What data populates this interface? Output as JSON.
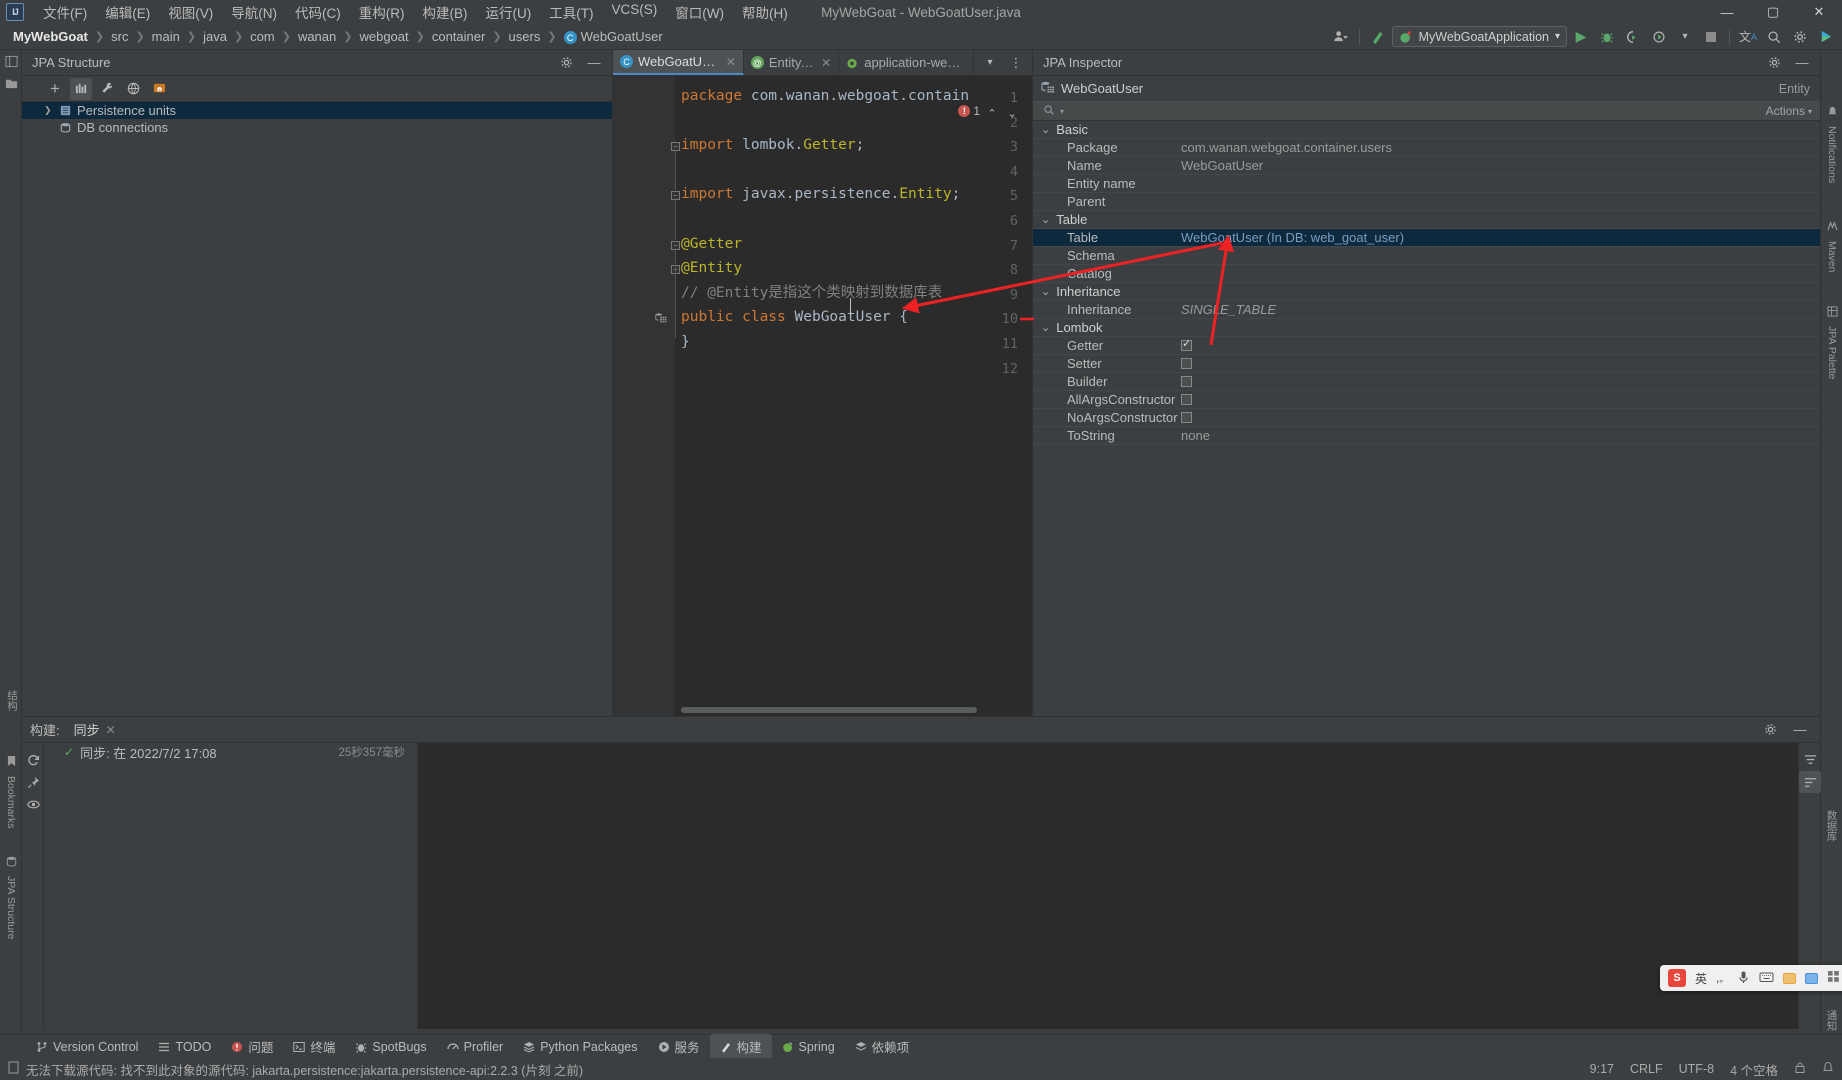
{
  "menubar": {
    "logo": "IJ",
    "items": [
      "文件(F)",
      "编辑(E)",
      "视图(V)",
      "导航(N)",
      "代码(C)",
      "重构(R)",
      "构建(B)",
      "运行(U)",
      "工具(T)",
      "VCS(S)",
      "窗口(W)",
      "帮助(H)"
    ],
    "window_title": "MyWebGoat - WebGoatUser.java",
    "minimize": "—",
    "maximize": "▢",
    "close": "✕"
  },
  "navbar": {
    "breadcrumbs": [
      "MyWebGoat",
      "src",
      "main",
      "java",
      "com",
      "wanan",
      "webgoat",
      "container",
      "users",
      "WebGoatUser"
    ],
    "class_badge": "C",
    "run_config": "MyWebGoatApplication",
    "dropdown_caret": "▾"
  },
  "left_rail": {
    "labels": [
      "Bookmarks",
      "JPA Structure"
    ],
    "vlabels_top": [
      "结构",
      "项目"
    ]
  },
  "right_rail": {
    "labels": [
      "Notifications",
      "Maven",
      "JPA Palette"
    ],
    "vlabels": [
      "通知",
      "数据库"
    ]
  },
  "jpa_structure": {
    "title": "JPA Structure",
    "toolbar_icons": [
      "add-icon",
      "chart-icon",
      "wrench-icon",
      "globe-icon",
      "db-console-icon"
    ],
    "tree": [
      {
        "label": "Persistence units",
        "expandable": true,
        "selected": true,
        "icon": "persistence-unit-icon"
      },
      {
        "label": "DB connections",
        "expandable": false,
        "selected": false,
        "icon": "database-icon"
      }
    ]
  },
  "editor": {
    "tabs": [
      {
        "label": "WebGoatUser.java",
        "icon": "java-class-icon",
        "active": true
      },
      {
        "label": "Entity.class",
        "icon": "annotation-icon",
        "active": false
      },
      {
        "label": "application-webgoat.pr",
        "icon": "spring-properties-icon",
        "active": false
      }
    ],
    "error_count": "1",
    "lines": [
      {
        "n": "1",
        "tokens": [
          {
            "t": "package ",
            "c": "kw"
          },
          {
            "t": "com.wanan.webgoat.contain",
            "c": "txt"
          }
        ]
      },
      {
        "n": "2",
        "tokens": []
      },
      {
        "n": "3",
        "fold": true,
        "tokens": [
          {
            "t": "import ",
            "c": "kw"
          },
          {
            "t": "lombok.",
            "c": "txt"
          },
          {
            "t": "Getter",
            "c": "ann"
          },
          {
            "t": ";",
            "c": "txt"
          }
        ]
      },
      {
        "n": "4",
        "tokens": []
      },
      {
        "n": "5",
        "fold": true,
        "tokens": [
          {
            "t": "import ",
            "c": "kw"
          },
          {
            "t": "javax.persistence.",
            "c": "txt"
          },
          {
            "t": "Entity",
            "c": "ann"
          },
          {
            "t": ";",
            "c": "txt"
          }
        ]
      },
      {
        "n": "6",
        "tokens": []
      },
      {
        "n": "7",
        "fold": true,
        "tokens": [
          {
            "t": "@Getter",
            "c": "ann"
          }
        ]
      },
      {
        "n": "8",
        "fold": true,
        "tokens": [
          {
            "t": "@Entity",
            "c": "ann"
          }
        ]
      },
      {
        "n": "9",
        "tokens": [
          {
            "t": "// @Entity是指这个类映射到数据库表",
            "c": "cmt"
          }
        ]
      },
      {
        "n": "10",
        "gutter_icon": "db-table-icon",
        "tokens": [
          {
            "t": "public ",
            "c": "kw"
          },
          {
            "t": "class ",
            "c": "kw"
          },
          {
            "t": "WebGoatUser",
            "c": "txt"
          },
          {
            "t": " {",
            "c": "txt"
          }
        ]
      },
      {
        "n": "11",
        "tokens": [
          {
            "t": "}",
            "c": "txt"
          }
        ]
      },
      {
        "n": "12",
        "tokens": []
      }
    ]
  },
  "inspector": {
    "title": "JPA Inspector",
    "entity_name": "WebGoatUser",
    "entity_badge": "Entity",
    "search_placeholder": "",
    "actions_label": "Actions",
    "groups": [
      {
        "name": "Basic",
        "rows": [
          {
            "name": "Package",
            "value": "com.wanan.webgoat.container.users",
            "type": "text"
          },
          {
            "name": "Name",
            "value": "WebGoatUser",
            "type": "text"
          },
          {
            "name": "Entity name",
            "value": "",
            "type": "text"
          },
          {
            "name": "Parent",
            "value": "",
            "type": "text"
          }
        ]
      },
      {
        "name": "Table",
        "rows": [
          {
            "name": "Table",
            "value": "WebGoatUser (In DB: web_goat_user)",
            "type": "link",
            "selected": true
          },
          {
            "name": "Schema",
            "value": "",
            "type": "text"
          },
          {
            "name": "Catalog",
            "value": "",
            "type": "text"
          }
        ]
      },
      {
        "name": "Inheritance",
        "rows": [
          {
            "name": "Inheritance",
            "value": "SINGLE_TABLE",
            "type": "italic"
          }
        ]
      },
      {
        "name": "Lombok",
        "rows": [
          {
            "name": "Getter",
            "value": "",
            "type": "checkbox",
            "checked": true
          },
          {
            "name": "Setter",
            "value": "",
            "type": "checkbox",
            "checked": false
          },
          {
            "name": "Builder",
            "value": "",
            "type": "checkbox",
            "checked": false
          },
          {
            "name": "AllArgsConstructor",
            "value": "",
            "type": "checkbox",
            "checked": false
          },
          {
            "name": "NoArgsConstructor",
            "value": "",
            "type": "checkbox",
            "checked": false
          },
          {
            "name": "ToString",
            "value": "none",
            "type": "text"
          }
        ]
      }
    ]
  },
  "build_panel": {
    "title": "构建:",
    "tab_label": "同步",
    "tab_close": "✕",
    "item_text": "同步: 在 2022/7/2 17:08",
    "item_duration": "25秒357毫秒",
    "check": "✓"
  },
  "toolwindow_bar": {
    "items": [
      {
        "label": "Version Control",
        "icon": "branch-icon",
        "active": false
      },
      {
        "label": "TODO",
        "icon": "list-icon",
        "active": false
      },
      {
        "label": "问题",
        "icon": "error-icon",
        "active": false
      },
      {
        "label": "终端",
        "icon": "terminal-icon",
        "active": false
      },
      {
        "label": "SpotBugs",
        "icon": "bug-icon",
        "active": false
      },
      {
        "label": "Profiler",
        "icon": "gauge-icon",
        "active": false
      },
      {
        "label": "Python Packages",
        "icon": "packages-icon",
        "active": false
      },
      {
        "label": "服务",
        "icon": "services-icon",
        "active": false
      },
      {
        "label": "构建",
        "icon": "hammer-icon",
        "active": true
      },
      {
        "label": "Spring",
        "icon": "spring-icon",
        "active": false
      },
      {
        "label": "依赖项",
        "icon": "dependencies-icon",
        "active": false
      }
    ]
  },
  "statusbar": {
    "message": "无法下载源代码: 找不到此对象的源代码: jakarta.persistence:jakarta.persistence-api:2.2.3 (片刻 之前)",
    "caret": "9:17",
    "line_sep": "CRLF",
    "encoding": "UTF-8",
    "indent": "4 个空格",
    "lock_icon": "lock-icon",
    "notify_icon": "bell-icon"
  },
  "ime_bar": {
    "logo": "S",
    "mode": "英",
    "items": [
      "comma-icon",
      "mic-icon",
      "keyboard-icon",
      "clipboard-yellow-icon",
      "clipboard-blue-icon",
      "grid-icon"
    ]
  },
  "colors": {
    "bg_panel": "#3c3f41",
    "bg_editor": "#2b2b2b",
    "bg_gutter": "#313335",
    "selection": "#0d293e",
    "accent_blue": "#4a88c7",
    "annotation_red": "#ee2222",
    "keyword_orange": "#cc7832",
    "annotation_yellow": "#bbb529",
    "text_grey": "#a9b7c6",
    "comment_grey": "#808080",
    "green_run": "#59a869",
    "error_red": "#c75450"
  }
}
